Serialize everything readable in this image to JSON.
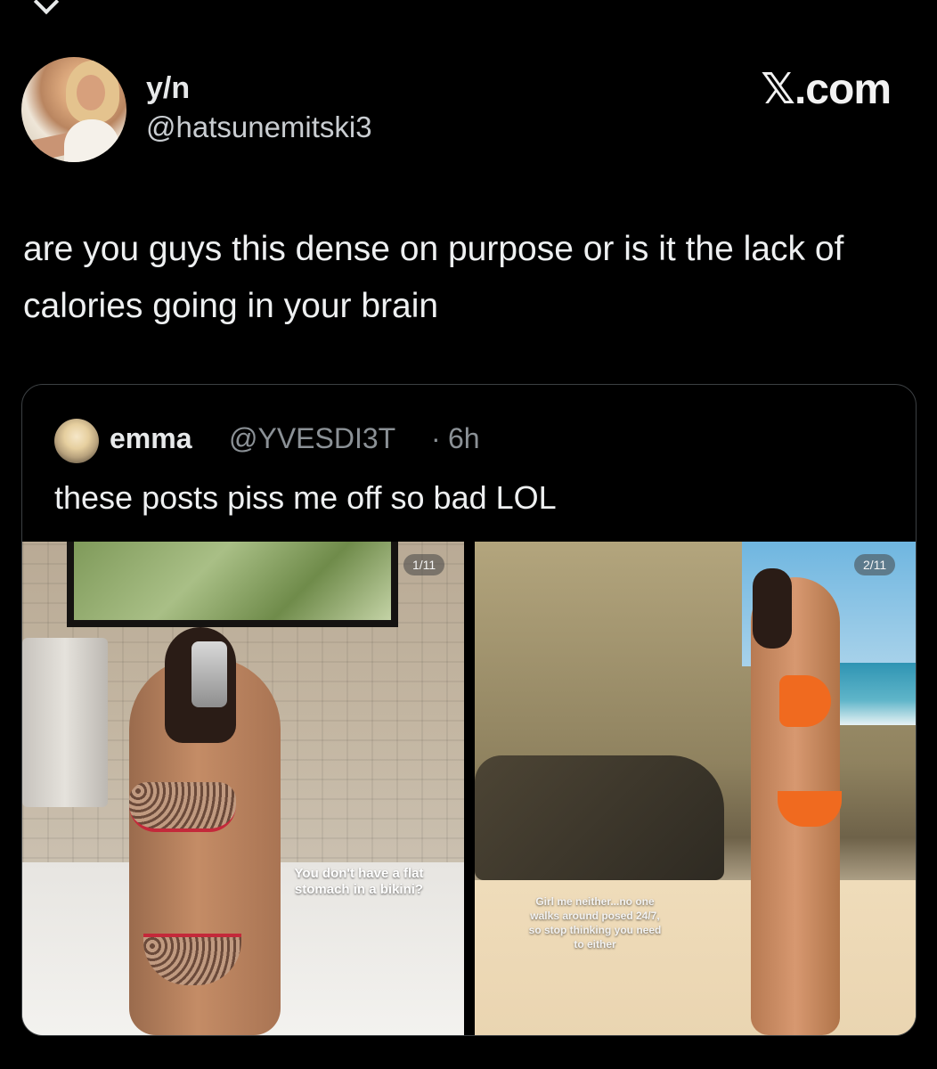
{
  "author": {
    "display_name": "y/n",
    "handle": "@hatsunemitski3"
  },
  "site_mark": "𝕏.com",
  "tweet_text": "are you guys this dense on purpose or is it the lack of calories going in your brain",
  "quote": {
    "display_name": "emma",
    "handle": "@YVESDI3T",
    "separator": "·",
    "time": "6h",
    "text": "these posts piss me off so bad LOL",
    "images": [
      {
        "counter": "1/11",
        "overlay_text": "You don't have a flat stomach in a bikini?"
      },
      {
        "counter": "2/11",
        "overlay_text": "Girl me neither...no one walks around posed 24/7, so stop thinking you need to either"
      }
    ]
  }
}
